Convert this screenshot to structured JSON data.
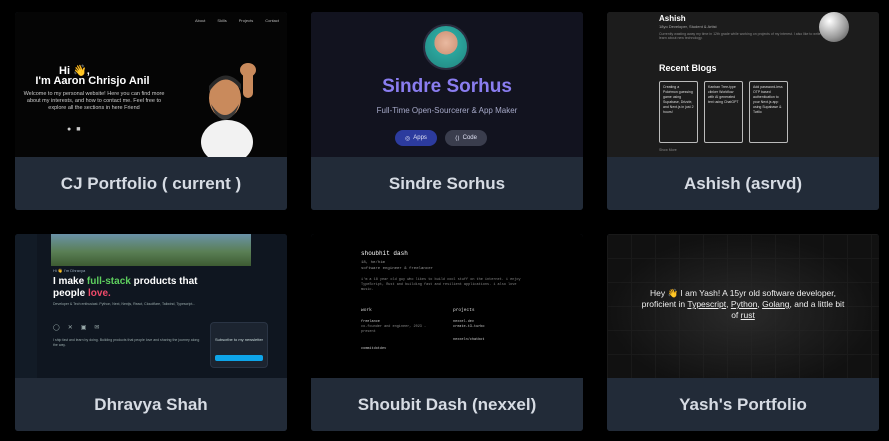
{
  "cards": [
    {
      "label": "CJ Portfolio ( current )",
      "thumb": {
        "nav": [
          "About",
          "Skills",
          "Projects",
          "Contact"
        ],
        "hi": "Hi 👋,",
        "name": "I'm Aaron Chrisjo Anil",
        "desc": "Welcome to my personal website! Here you can find more about my interests, and how to contact me. Feel free to explore all the sections in here Friend",
        "icons": [
          "github-icon",
          "linkedin-icon"
        ]
      }
    },
    {
      "label": "Sindre Sorhus",
      "thumb": {
        "title": "Sindre Sorhus",
        "subtitle": "Full-Time Open-Sourcerer & App Maker",
        "btn_apps": "Apps",
        "btn_code": "Code"
      }
    },
    {
      "label": "Ashish (asrvd)",
      "thumb": {
        "name": "Ashish",
        "meta": "18yo Developer, Student & Artist",
        "line": "Currently wasting away my time in 12th grade while working on projects of my interest. I also like to write and learn about new technology.",
        "recent": "Recent Blogs",
        "blogs": [
          "Creating a Pokémon guessing game using Supabase, Drizzle, and Next.js in just 2 hours!",
          "Kanban Tree-type clinker Workflow with AI generated text using ChatGPT",
          "Add password-less OTP based authentication to your Next.js app using Supabase & Twilio"
        ],
        "more": "Show More"
      }
    },
    {
      "label": "Dhravya Shah",
      "thumb": {
        "handle": "Hi 👋 I'm Dhravya",
        "head_pre": "I make ",
        "head_green": "full-stack",
        "head_mid": " products that people ",
        "head_red": "love.",
        "stack": "Developer & Tech enthusiast. Python, Next, Nextjs, React, Cloudflare, Tailwind, Typescript...",
        "para": "I ship fast and learn by doing. Building products that people love and sharing the journey along the way.",
        "newsletter": "Subscribe to my newsletter"
      }
    },
    {
      "label": "Shoubit Dash (nexxel)",
      "thumb": {
        "title": "shoubhit dash",
        "sub1": "18, he/him",
        "sub2": "software engineer & freelancer",
        "para": "i'm a 18 year old guy who likes to build cool stuff on the internet. i enjoy TypeScript, Rust and building fast and resilient applications. i also love music.",
        "work": "work",
        "work_item": "freelance",
        "work_desc": "co-founder and engineer, 2023 - present",
        "work_item2": "commitdotdev",
        "projects": "projects",
        "proj1": "nexxel.dev",
        "proj2": "create-t3-turbo",
        "proj3": "nexxeln/chatbot"
      }
    },
    {
      "label": "Yash's Portfolio",
      "thumb": {
        "text_pre": "Hey 👋 I am Yash! A 15yr old software developer, proficient in ",
        "lang1": "Typescript",
        "sep1": ",",
        "lang2": "Python",
        "sep2": ",",
        "lang3": "Golang",
        "sep3": ", and a little bit of ",
        "lang4": "rust"
      }
    }
  ]
}
